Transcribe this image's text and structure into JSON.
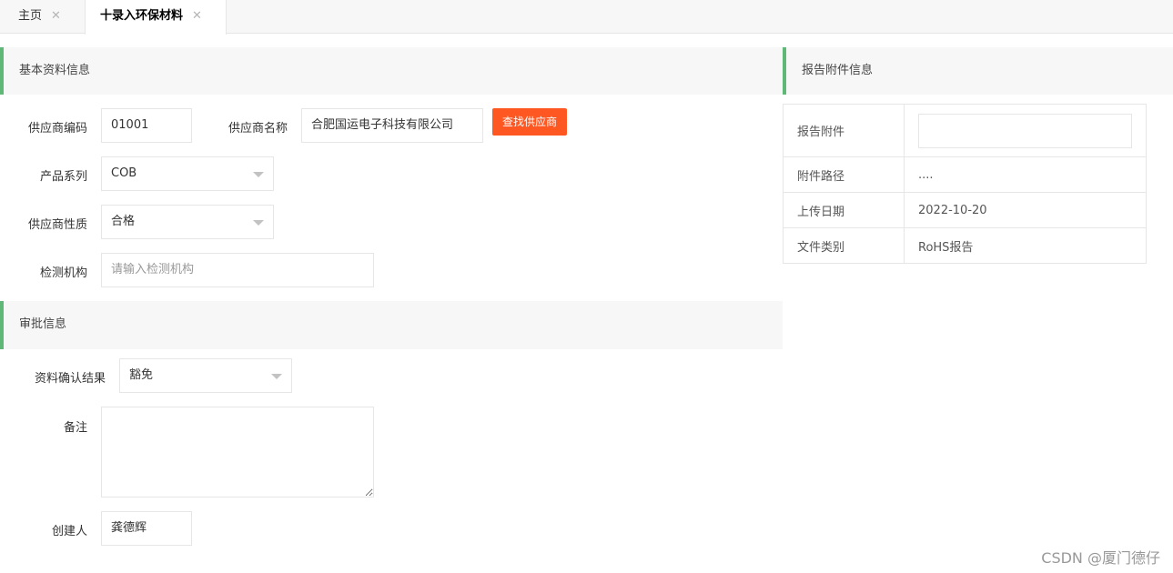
{
  "tabs": {
    "home": "主页",
    "active": "十录入环保材料",
    "close": "✕"
  },
  "basic": {
    "title": "基本资料信息",
    "supplier_code_label": "供应商编码",
    "supplier_code": "01001",
    "supplier_name_label": "供应商名称",
    "supplier_name": "合肥国运电子科技有限公司",
    "find_button": "查找供应商",
    "product_series_label": "产品系列",
    "product_series": "COB",
    "supplier_nature_label": "供应商性质",
    "supplier_nature": "合格",
    "test_org_label": "检测机构",
    "test_org_placeholder": "请输入检测机构"
  },
  "approval": {
    "title": "审批信息",
    "confirm_label": "资料确认结果",
    "confirm_value": "豁免",
    "remark_label": "备注",
    "creator_label": "创建人",
    "creator": "龚德辉"
  },
  "report": {
    "title": "报告附件信息",
    "rows": [
      {
        "key": "报告附件",
        "value": ""
      },
      {
        "key": "附件路径",
        "value": "...."
      },
      {
        "key": "上传日期",
        "value": "2022-10-20"
      },
      {
        "key": "文件类别",
        "value": "RoHS报告"
      }
    ]
  },
  "watermark": "CSDN @厦门德仔",
  "colors": {
    "accent_green": "#5fb878",
    "button_orange": "#ff5722"
  }
}
